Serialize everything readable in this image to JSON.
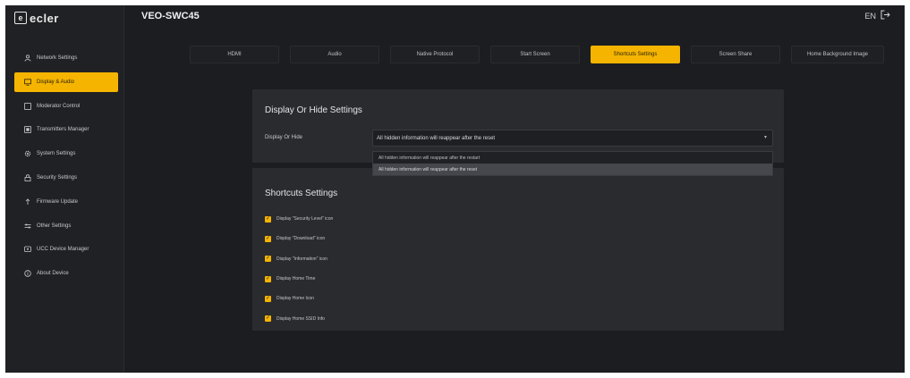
{
  "brand": {
    "logo_text": "ecler"
  },
  "header": {
    "title": "VEO-SWC45",
    "language": "EN",
    "logout_icon": "logout-icon"
  },
  "sidebar": {
    "items": [
      {
        "label": "Network Settings",
        "icon": "user-icon",
        "active": false
      },
      {
        "label": "Display & Audio",
        "icon": "display-icon",
        "active": true
      },
      {
        "label": "Moderator Control",
        "icon": "square-icon",
        "active": false
      },
      {
        "label": "Transmitters Manager",
        "icon": "transmitter-icon",
        "active": false
      },
      {
        "label": "System Settings",
        "icon": "gear-icon",
        "active": false
      },
      {
        "label": "Security Settings",
        "icon": "lock-icon",
        "active": false
      },
      {
        "label": "Firmware Update",
        "icon": "upload-icon",
        "active": false
      },
      {
        "label": "Other Settings",
        "icon": "sliders-icon",
        "active": false
      },
      {
        "label": "UCC Device Manager",
        "icon": "device-icon",
        "active": false
      },
      {
        "label": "About Device",
        "icon": "info-icon",
        "active": false
      }
    ]
  },
  "tabs": [
    {
      "label": "HDMI",
      "active": false
    },
    {
      "label": "Audio",
      "active": false
    },
    {
      "label": "Native Protocol",
      "active": false
    },
    {
      "label": "Start Screen",
      "active": false
    },
    {
      "label": "Shortcuts Settings",
      "active": true
    },
    {
      "label": "Screen Share",
      "active": false
    },
    {
      "label": "Home Background Image",
      "active": false
    }
  ],
  "display_panel": {
    "title": "Display Or Hide Settings",
    "field_label": "Display Or Hide",
    "selected_value": "All hidden information will reappear after the reset",
    "options": [
      "All hidden information will reappear after the restart",
      "All hidden information will reappear after the reset"
    ]
  },
  "shortcuts_panel": {
    "title": "Shortcuts Settings",
    "items": [
      {
        "label": "Display \"Security Level\" icon",
        "checked": true
      },
      {
        "label": "Display \"Download\" icon",
        "checked": true
      },
      {
        "label": "Display \"Information\" icon",
        "checked": true
      },
      {
        "label": "Display Home Time",
        "checked": true
      },
      {
        "label": "Display Home Icon",
        "checked": true
      },
      {
        "label": "Display Home SSID Info",
        "checked": true
      }
    ]
  },
  "colors": {
    "accent": "#f5b400",
    "background": "#1c1d20",
    "panel": "#2a2b2f"
  }
}
